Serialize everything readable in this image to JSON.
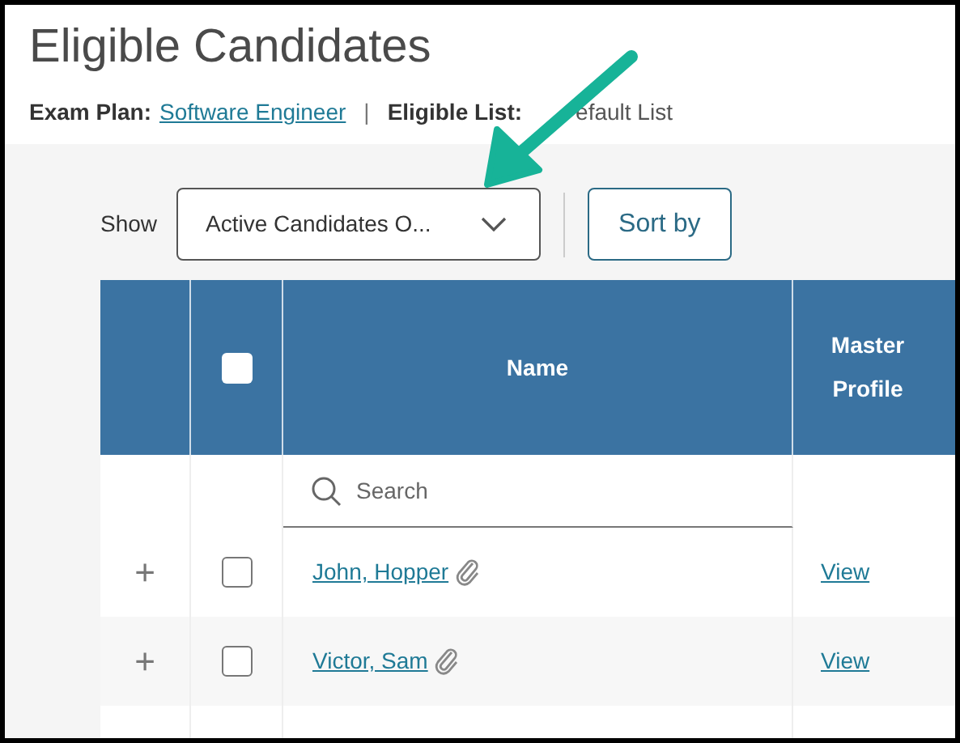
{
  "title": "Eligible Candidates",
  "meta": {
    "exam_plan_label": "Exam Plan:",
    "exam_plan": "Software Engineer",
    "separator": "|",
    "list_label": "Eligible List:",
    "list_value": "efault List"
  },
  "toolbar": {
    "show_label": "Show",
    "dropdown": "Active Candidates O...",
    "sort_button": "Sort by"
  },
  "table": {
    "columns": [
      "Name",
      "Master Profile"
    ],
    "select_all_checked": false,
    "search_placeholder": "Search",
    "rows": [
      {
        "expand": "+",
        "checked": false,
        "name": "John, Hopper",
        "attachment": true,
        "profile": "View"
      },
      {
        "expand": "+",
        "checked": false,
        "name": "Victor, Sam",
        "attachment": true,
        "profile": "View"
      }
    ]
  }
}
